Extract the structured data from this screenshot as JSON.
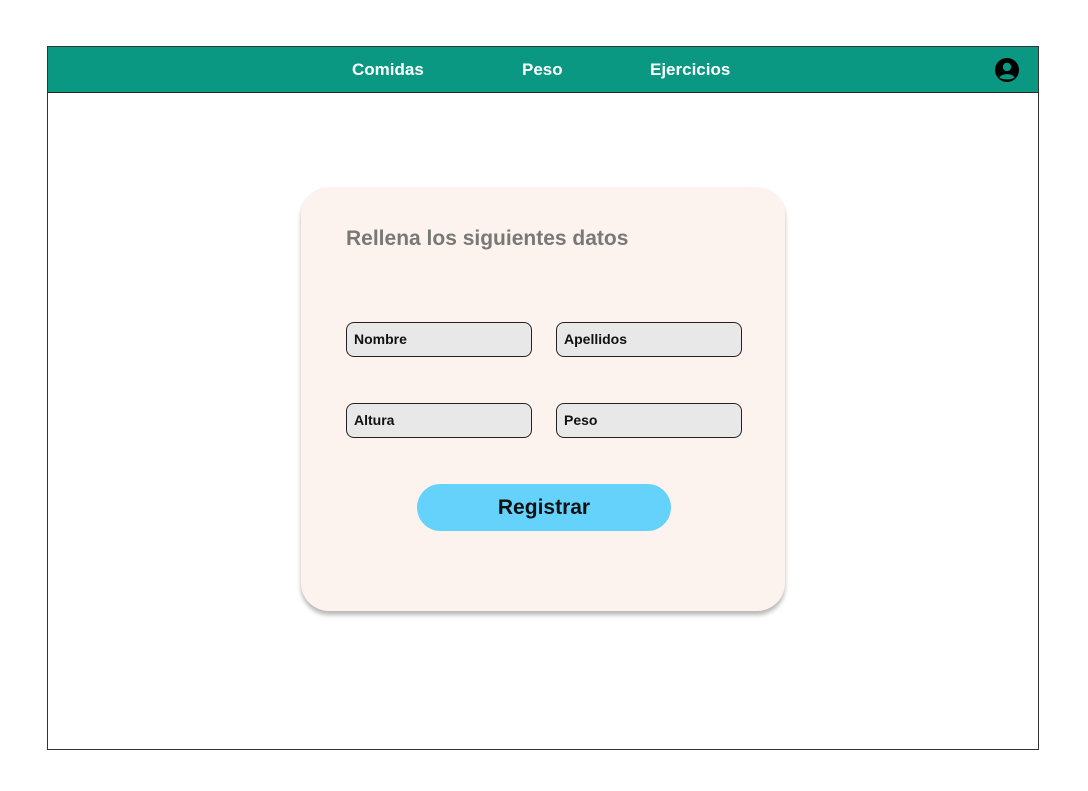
{
  "nav": {
    "items": [
      {
        "label": "Comidas"
      },
      {
        "label": "Peso"
      },
      {
        "label": "Ejercicios"
      }
    ],
    "user_icon": "user-circle-icon",
    "bar_color": "#0b9882"
  },
  "form": {
    "title": "Rellena los siguientes datos",
    "fields": {
      "nombre": "Nombre",
      "apellidos": "Apellidos",
      "altura": "Altura",
      "peso": "Peso"
    },
    "submit_label": "Registrar",
    "card_color": "#fcf3ef",
    "button_color": "#64d2fb"
  }
}
